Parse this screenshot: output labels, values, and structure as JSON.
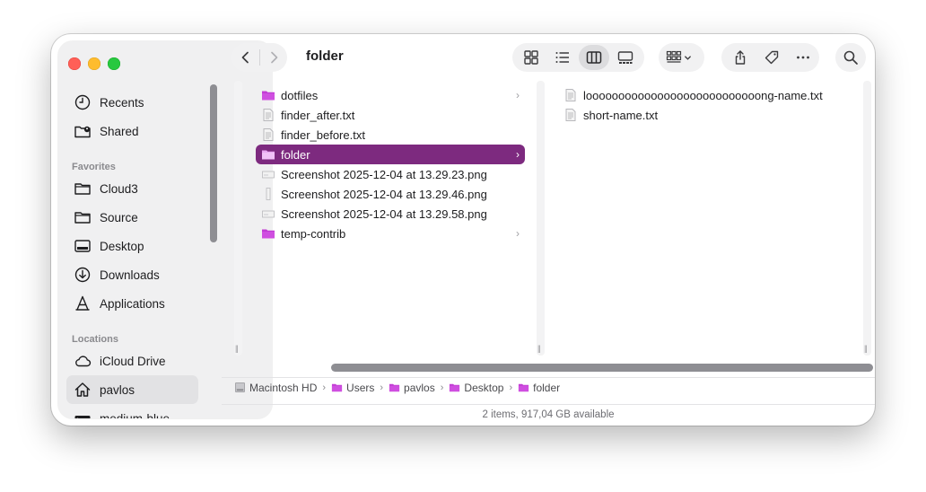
{
  "window": {
    "title": "folder"
  },
  "sidebar": {
    "top_items": [
      {
        "label": "Recents",
        "icon": "clock-icon"
      },
      {
        "label": "Shared",
        "icon": "shared-folder-icon"
      }
    ],
    "favorites_heading": "Favorites",
    "favorites": [
      {
        "label": "Cloud3",
        "icon": "folder-icon"
      },
      {
        "label": "Source",
        "icon": "folder-icon"
      },
      {
        "label": "Desktop",
        "icon": "desktop-icon"
      },
      {
        "label": "Downloads",
        "icon": "download-icon"
      },
      {
        "label": "Applications",
        "icon": "applications-icon"
      }
    ],
    "locations_heading": "Locations",
    "locations": [
      {
        "label": "iCloud Drive",
        "icon": "cloud-icon"
      },
      {
        "label": "pavlos",
        "icon": "home-icon",
        "selected": true
      },
      {
        "label": "medium-blue",
        "icon": "drive-icon"
      }
    ]
  },
  "column1": {
    "items": [
      {
        "label": "dotfiles",
        "type": "folder",
        "has_children": true
      },
      {
        "label": "finder_after.txt",
        "type": "text"
      },
      {
        "label": "finder_before.txt",
        "type": "text"
      },
      {
        "label": "folder",
        "type": "folder",
        "has_children": true,
        "selected": true
      },
      {
        "label": "Screenshot 2025-12-04 at 13.29.23.png",
        "type": "image"
      },
      {
        "label": "Screenshot 2025-12-04 at 13.29.46.png",
        "type": "image-tall"
      },
      {
        "label": "Screenshot 2025-12-04 at 13.29.58.png",
        "type": "image"
      },
      {
        "label": "temp-contrib",
        "type": "folder",
        "has_children": true
      }
    ]
  },
  "column2": {
    "items": [
      {
        "label": "looooooooooooooooooooooooooong-name.txt",
        "type": "text"
      },
      {
        "label": "short-name.txt",
        "type": "text"
      }
    ]
  },
  "pathbar": {
    "segments": [
      {
        "label": "Macintosh HD",
        "icon": "disk-icon"
      },
      {
        "label": "Users",
        "icon": "folder-icon"
      },
      {
        "label": "pavlos",
        "icon": "folder-icon"
      },
      {
        "label": "Desktop",
        "icon": "folder-icon"
      },
      {
        "label": "folder",
        "icon": "folder-icon"
      }
    ],
    "separator": "›"
  },
  "status": {
    "text": "2 items, 917,04 GB available"
  },
  "colors": {
    "accent": "#7d2a7f",
    "folder": "#c23bd4"
  }
}
